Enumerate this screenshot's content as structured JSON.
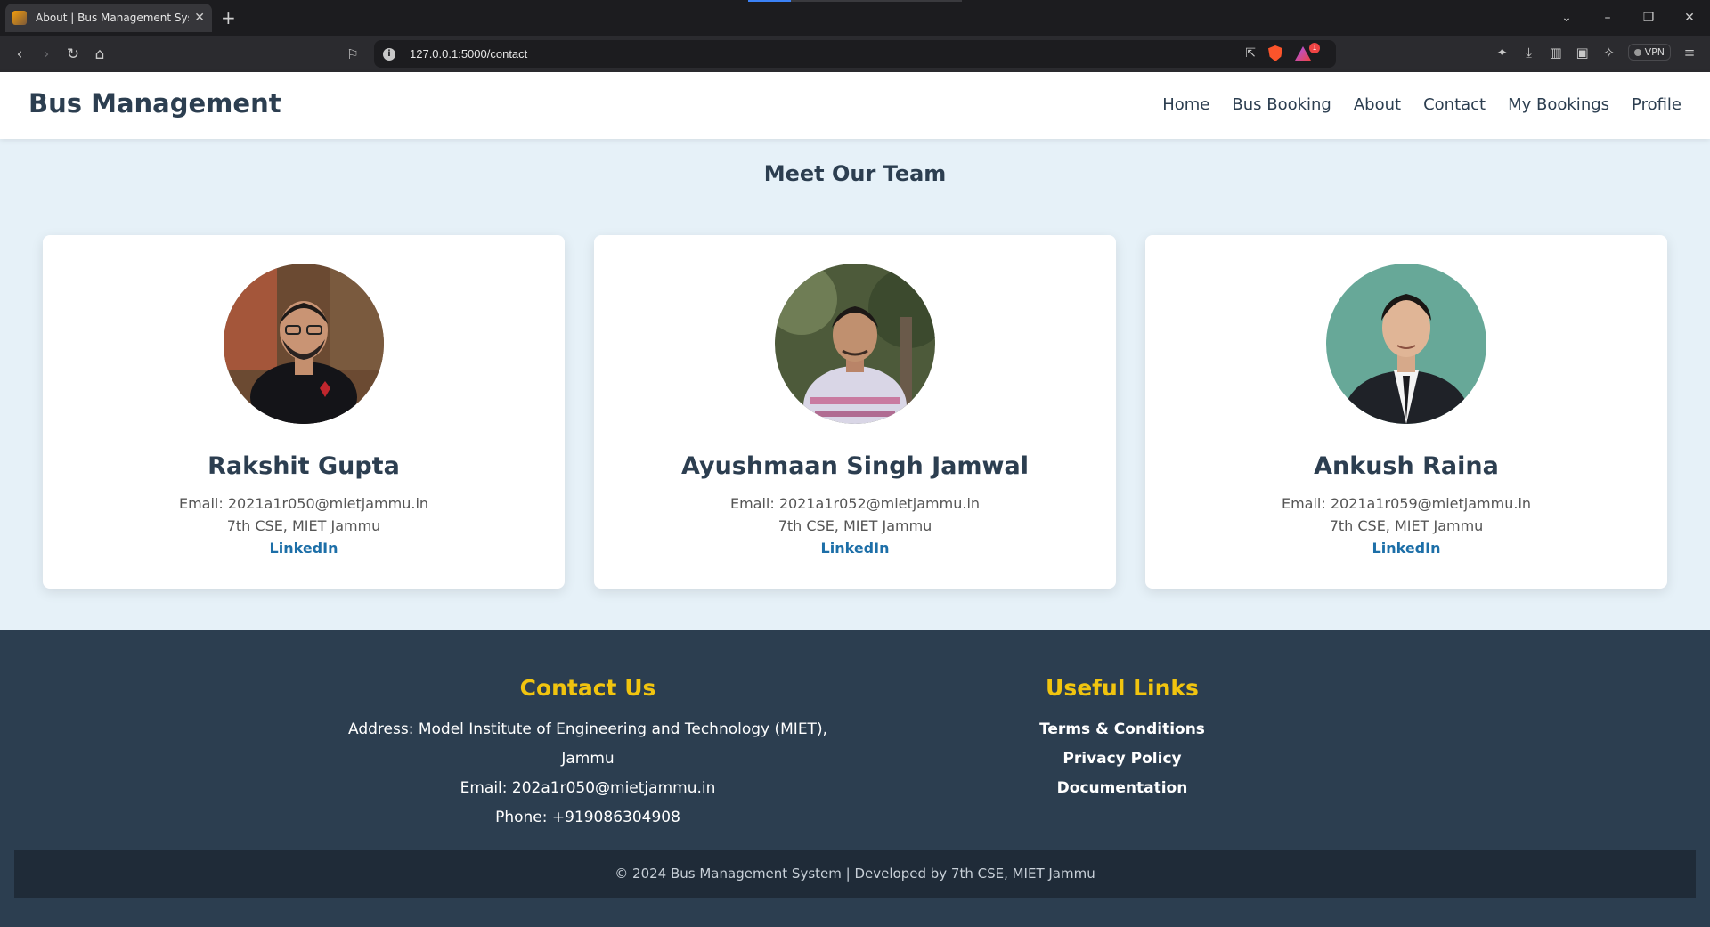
{
  "browser": {
    "tab_title": "About | Bus Management System",
    "url": "127.0.0.1:5000/contact",
    "vpn_label": "VPN",
    "rewards_badge": "1"
  },
  "site": {
    "brand": "Bus Management",
    "nav": [
      "Home",
      "Bus Booking",
      "About",
      "Contact",
      "My Bookings",
      "Profile"
    ]
  },
  "team": {
    "title": "Meet Our Team",
    "members": [
      {
        "name": "Rakshit Gupta",
        "email": "Email: 2021a1r050@mietjammu.in",
        "dept": "7th CSE, MIET Jammu",
        "link": "LinkedIn"
      },
      {
        "name": "Ayushmaan Singh Jamwal",
        "email": "Email: 2021a1r052@mietjammu.in",
        "dept": "7th CSE, MIET Jammu",
        "link": "LinkedIn"
      },
      {
        "name": "Ankush Raina",
        "email": "Email: 2021a1r059@mietjammu.in",
        "dept": "7th CSE, MIET Jammu",
        "link": "LinkedIn"
      }
    ]
  },
  "footer": {
    "contact_heading": "Contact Us",
    "address": "Address: Model Institute of Engineering and Technology (MIET), Jammu",
    "email": "Email: 202a1r050@mietjammu.in",
    "phone": "Phone: +919086304908",
    "links_heading": "Useful Links",
    "links": [
      "Terms & Conditions",
      "Privacy Policy",
      "Documentation"
    ],
    "copyright": "© 2024 Bus Management System | Developed by 7th CSE, MIET Jammu"
  },
  "colors": {
    "header_text": "#2c3e50",
    "footer_bg": "#2c3e50",
    "footer_heading": "#f1c40f",
    "link": "#1d6fa8",
    "page_bg": "#e6f1f8"
  }
}
